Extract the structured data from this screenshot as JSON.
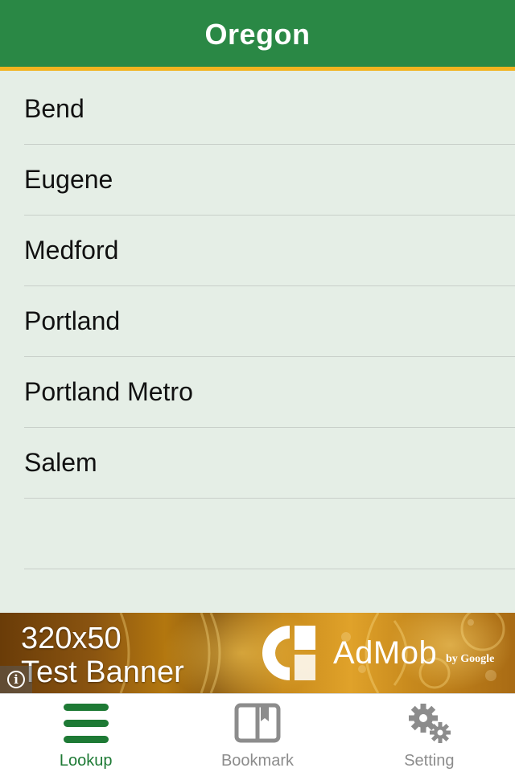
{
  "header": {
    "title": "Oregon"
  },
  "cities": [
    {
      "label": "Bend"
    },
    {
      "label": "Eugene"
    },
    {
      "label": "Medford"
    },
    {
      "label": "Portland"
    },
    {
      "label": "Portland Metro"
    },
    {
      "label": "Salem"
    },
    {
      "label": ""
    }
  ],
  "ad": {
    "line1": "320x50",
    "line2": "Test Banner",
    "brand": "AdMob",
    "by": "by Google",
    "info_icon": "info-icon"
  },
  "tabs": [
    {
      "label": "Lookup",
      "icon": "list-icon",
      "active": true
    },
    {
      "label": "Bookmark",
      "icon": "book-icon",
      "active": false
    },
    {
      "label": "Setting",
      "icon": "gears-icon",
      "active": false
    }
  ],
  "colors": {
    "header_bg": "#2a8845",
    "header_border": "#f2b31f",
    "list_bg": "#e5eee6",
    "active_tab": "#1e7a35",
    "inactive_tab": "#8c8c8c"
  }
}
